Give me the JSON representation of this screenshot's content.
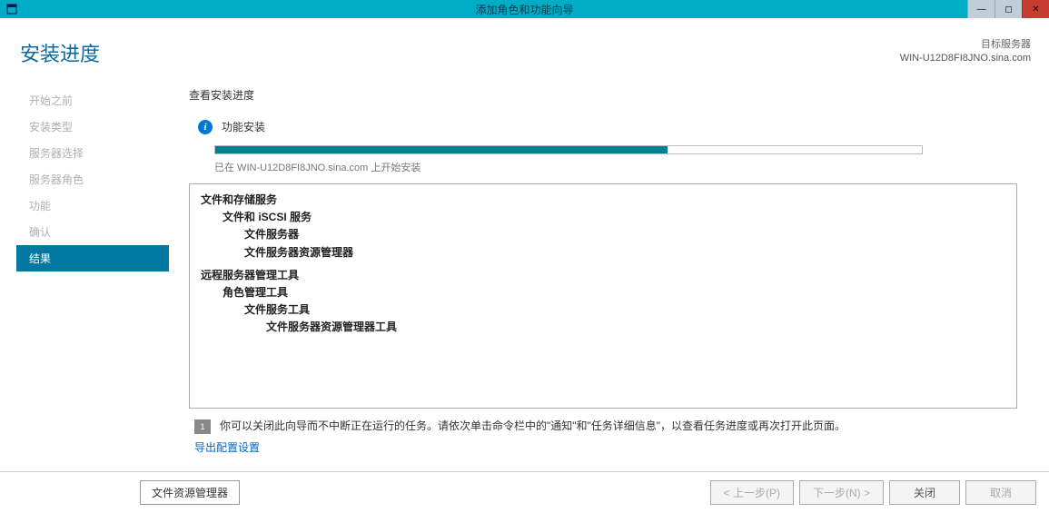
{
  "window": {
    "title": "添加角色和功能向导"
  },
  "header": {
    "page_title": "安装进度",
    "target_label": "目标服务器",
    "target_name": "WIN-U12D8FI8JNO.sina.com"
  },
  "sidebar": {
    "items": [
      {
        "label": "开始之前"
      },
      {
        "label": "安装类型"
      },
      {
        "label": "服务器选择"
      },
      {
        "label": "服务器角色"
      },
      {
        "label": "功能"
      },
      {
        "label": "确认"
      },
      {
        "label": "结果"
      }
    ]
  },
  "content": {
    "section_label": "查看安装进度",
    "install_label": "功能安装",
    "progress_status": "已在 WIN-U12D8FI8JNO.sina.com 上开始安装",
    "tree": {
      "g1_l0": "文件和存储服务",
      "g1_l1": "文件和 iSCSI 服务",
      "g1_l2a": "文件服务器",
      "g1_l2b": "文件服务器资源管理器",
      "g2_l0": "远程服务器管理工具",
      "g2_l1": "角色管理工具",
      "g2_l2": "文件服务工具",
      "g2_l3": "文件服务器资源管理器工具"
    },
    "hint_text": "你可以关闭此向导而不中断正在运行的任务。请依次单击命令栏中的\"通知\"和\"任务详细信息\"，以查看任务进度或再次打开此页面。",
    "export_link": "导出配置设置",
    "flag_badge": "1"
  },
  "bottom": {
    "file_mgr": "文件资源管理器",
    "prev": "< 上一步(P)",
    "next": "下一步(N) >",
    "close": "关闭",
    "cancel": "取消"
  }
}
